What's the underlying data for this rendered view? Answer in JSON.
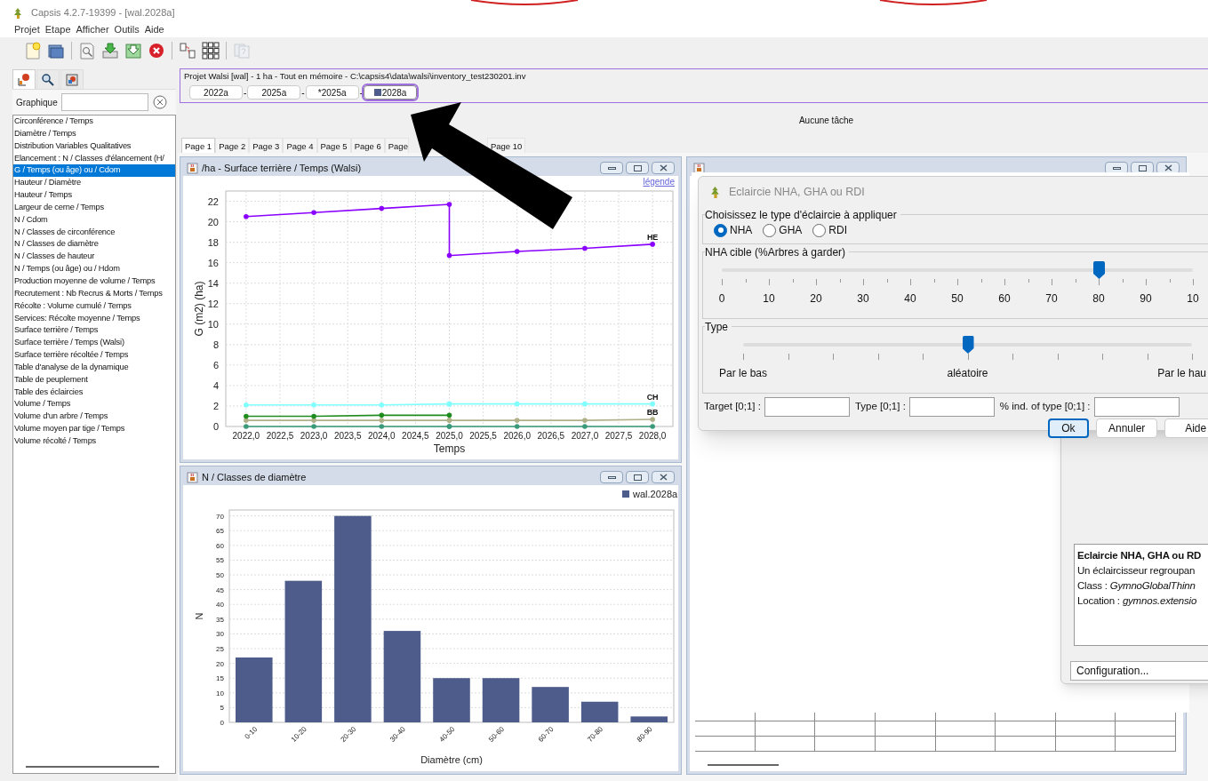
{
  "window": {
    "title": "Capsis 4.2.7-19399 - [wal.2028a]"
  },
  "menu": [
    "Projet",
    "Etape",
    "Afficher",
    "Outils",
    "Aide"
  ],
  "toolbar": [
    {
      "kind": "new",
      "disabled": false
    },
    {
      "kind": "open",
      "disabled": false
    },
    {
      "kind": "inspect",
      "disabled": false
    },
    {
      "kind": "download",
      "disabled": false
    },
    {
      "kind": "download2",
      "disabled": false
    },
    {
      "kind": "close",
      "disabled": false
    },
    {
      "kind": "link",
      "disabled": false
    },
    {
      "kind": "grid",
      "disabled": false
    },
    {
      "kind": "help",
      "disabled": true
    }
  ],
  "left_panel": {
    "tabs": [
      {
        "kind": "chart",
        "selected": true
      },
      {
        "kind": "search",
        "selected": false
      },
      {
        "kind": "map",
        "selected": false
      }
    ],
    "filter_label": "Graphique",
    "items": [
      {
        "label": "Circonférence / Temps",
        "selected": false
      },
      {
        "label": "Diamètre / Temps",
        "selected": false
      },
      {
        "label": "Distribution Variables Qualitatives",
        "selected": false
      },
      {
        "label": "Elancement : N / Classes d'élancement (H/",
        "selected": false
      },
      {
        "label": "G / Temps (ou âge) ou / Cdom",
        "selected": true
      },
      {
        "label": "Hauteur / Diamètre",
        "selected": false
      },
      {
        "label": "Hauteur / Temps",
        "selected": false
      },
      {
        "label": "Largeur de cerne / Temps",
        "selected": false
      },
      {
        "label": "N / Cdom",
        "selected": false
      },
      {
        "label": "N / Classes de circonférence",
        "selected": false
      },
      {
        "label": "N / Classes de diamètre",
        "selected": false
      },
      {
        "label": "N / Classes de hauteur",
        "selected": false
      },
      {
        "label": "N / Temps (ou âge) ou / Hdom",
        "selected": false
      },
      {
        "label": "Production moyenne de volume / Temps",
        "selected": false
      },
      {
        "label": "Recrutement :  Nb Recrus & Morts / Temps",
        "selected": false
      },
      {
        "label": "Récolte : Volume cumulé / Temps",
        "selected": false
      },
      {
        "label": "Services: Récolte moyenne / Temps",
        "selected": false
      },
      {
        "label": "Surface terrière / Temps",
        "selected": false
      },
      {
        "label": "Surface terrière / Temps (Walsi)",
        "selected": false
      },
      {
        "label": "Surface terrière récoltée / Temps",
        "selected": false
      },
      {
        "label": "Table d'analyse de la dynamique",
        "selected": false
      },
      {
        "label": "Table de peuplement",
        "selected": false
      },
      {
        "label": "Table des éclaircies",
        "selected": false
      },
      {
        "label": "Volume / Temps",
        "selected": false
      },
      {
        "label": "Volume d'un arbre / Temps",
        "selected": false
      },
      {
        "label": "Volume moyen par tige / Temps",
        "selected": false
      },
      {
        "label": "Volume récolté / Temps",
        "selected": false
      }
    ]
  },
  "project": {
    "title": "Projet Walsi [wal] - 1 ha - Tout en mémoire - C:\\capsis4\\data\\walsi\\inventory_test230201.inv",
    "separator": "-",
    "steps": [
      {
        "label": "2022a",
        "selected": false
      },
      {
        "label": "2025a",
        "selected": false
      },
      {
        "label": "*2025a",
        "selected": false
      },
      {
        "label": "2028a",
        "selected": true
      }
    ]
  },
  "task_status": "Aucune tâche",
  "page_tabs": [
    {
      "label": "Page 1",
      "selected": true
    },
    {
      "label": "Page 2",
      "selected": false
    },
    {
      "label": "Page 3",
      "selected": false
    },
    {
      "label": "Page 4",
      "selected": false
    },
    {
      "label": "Page 5",
      "selected": false
    },
    {
      "label": "Page 6",
      "selected": false
    },
    {
      "label": "Page",
      "selected": false
    },
    {
      "label": "Page 10",
      "selected": false
    }
  ],
  "windows": [
    {
      "kind": "chart",
      "title": "/ha - Surface terrière / Temps (Walsi)",
      "legend_link": "légende",
      "chart_data": {
        "type": "line",
        "xlabel": "Temps",
        "ylabel": "G (m2) (ha)",
        "x": [
          2022,
          2023,
          2024,
          2025,
          2025,
          2026,
          2027,
          2028
        ],
        "xlim": [
          2021.7,
          2028.3
        ],
        "ylim": [
          0,
          23
        ],
        "xticks": [
          {
            "value": 2022,
            "label": "2022,0"
          },
          {
            "value": 2022.5,
            "label": "2022,5"
          },
          {
            "value": 2023,
            "label": "2023,0"
          },
          {
            "value": 2023.5,
            "label": "2023,5"
          },
          {
            "value": 2024,
            "label": "2024,0"
          },
          {
            "value": 2024.5,
            "label": "2024,5"
          },
          {
            "value": 2025,
            "label": "2025,0"
          },
          {
            "value": 2025.5,
            "label": "2025,5"
          },
          {
            "value": 2026,
            "label": "2026,0"
          },
          {
            "value": 2026.5,
            "label": "2026,5"
          },
          {
            "value": 2027,
            "label": "2027,0"
          },
          {
            "value": 2027.5,
            "label": "2027,5"
          },
          {
            "value": 2028,
            "label": "2028,0"
          }
        ],
        "yticks": [
          0,
          2,
          4,
          6,
          8,
          10,
          12,
          14,
          16,
          18,
          20,
          22
        ],
        "grid": true,
        "series": [
          {
            "name": "HE",
            "color": "#8a00ff",
            "values": [
              20.5,
              20.9,
              21.3,
              21.7,
              16.7,
              17.1,
              17.4,
              17.8
            ]
          },
          {
            "name": "CH",
            "color": "#80ffff",
            "values": [
              2.1,
              2.1,
              2.1,
              2.2,
              2.2,
              2.2,
              2.2,
              2.2
            ]
          },
          {
            "name": "BB",
            "color": "#b0b088",
            "values": [
              0.6,
              0.6,
              0.6,
              0.6,
              0.6,
              0.6,
              0.6,
              0.7
            ]
          },
          {
            "color": "#1e8c1e",
            "values": [
              1.0,
              1.0,
              1.1,
              1.1,
              null,
              null,
              null,
              null
            ]
          },
          {
            "color": "#3a9a7a",
            "values": [
              0,
              0,
              0,
              0,
              0,
              0,
              0,
              0
            ]
          }
        ]
      }
    },
    {
      "kind": "chart",
      "title": "N / Classes de diamètre",
      "chart_data": {
        "type": "bar",
        "grid": true,
        "xlabel": "Diamètre (cm)",
        "ylabel": "N",
        "categories": [
          "0-10",
          "10-20",
          "20-30",
          "30-40",
          "40-50",
          "50-60",
          "60-70",
          "70-80",
          "80-90"
        ],
        "ylim": [
          0,
          72
        ],
        "yticks": [
          0,
          5,
          10,
          15,
          20,
          25,
          30,
          35,
          40,
          45,
          50,
          55,
          60,
          65,
          70
        ],
        "series": [
          {
            "name": "wal.2028a",
            "color": "#4e5c8b",
            "values": [
              22,
              48,
              70,
              31,
              15,
              15,
              12,
              7,
              2
            ]
          }
        ]
      }
    },
    {
      "kind": "table"
    }
  ],
  "dialog": {
    "title": "Eclaircie NHA, GHA ou RDI",
    "type_group": "Choisissez le type d'éclaircie à appliquer",
    "options": [
      {
        "label": "NHA",
        "selected": true
      },
      {
        "label": "GHA",
        "selected": false
      },
      {
        "label": "RDI",
        "selected": false
      }
    ],
    "target_group": "NHA cible (%Arbres à garder)",
    "target_slider": {
      "level": 0.8,
      "labels": [
        "0",
        "10",
        "20",
        "30",
        "40",
        "50",
        "60",
        "70",
        "80",
        "90",
        "10"
      ]
    },
    "kind_group": "Type",
    "kind_slider": {
      "level": 0.5,
      "labels": [
        "Par le bas",
        "aléatoire",
        "Par le hau"
      ]
    },
    "fields": [
      "Target [0;1] :",
      "Type [0;1] :",
      "% ind. of type [0;1] :"
    ],
    "buttons": [
      {
        "label": "Ok",
        "default": true
      },
      {
        "label": "Annuler",
        "default": false
      },
      {
        "label": "Aide",
        "default": false
      }
    ]
  },
  "description": {
    "title": "Eclaircie NHA, GHA ou RD",
    "lines": [
      "Un éclaircisseur regroupan",
      "Class : *GymnoGlobalThinn*",
      "Location : *gymnos.extensio*"
    ],
    "config_button": "Configuration..."
  }
}
